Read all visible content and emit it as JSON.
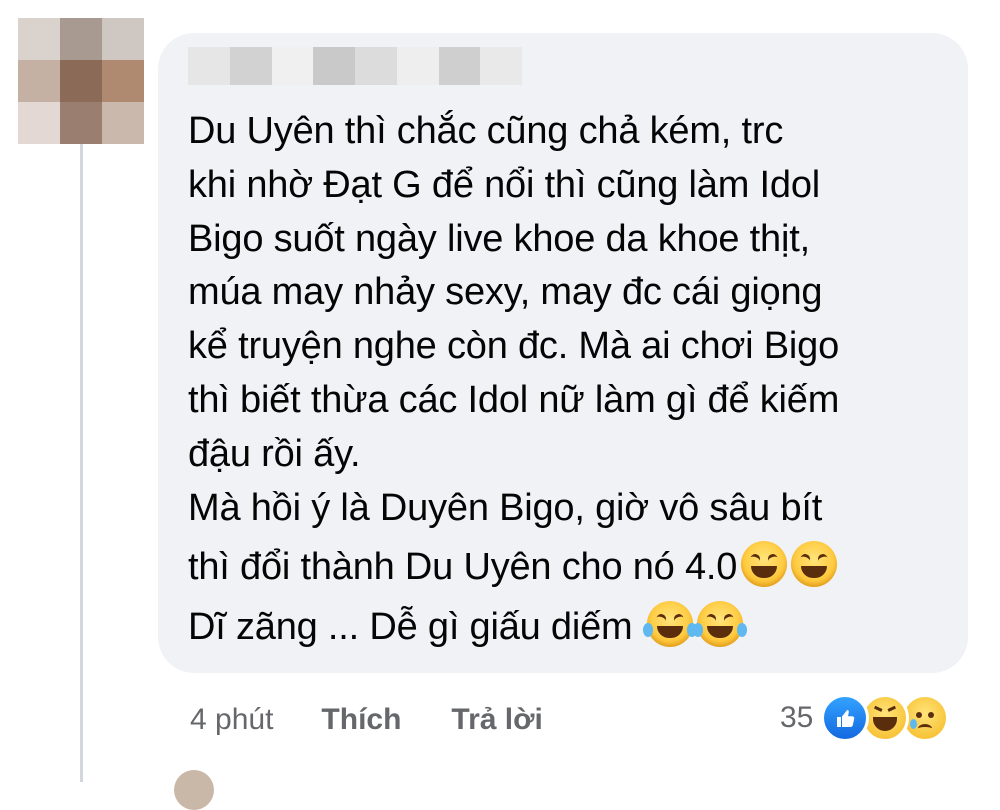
{
  "avatar": {
    "pixels": [
      "#d9d2cd",
      "#a89a90",
      "#cfc7c2",
      "#c4b1a4",
      "#8b6a58",
      "#b08a70",
      "#e3d8d4",
      "#9a7e70",
      "#cbb8ad"
    ]
  },
  "comment": {
    "author_name_blur_colors": [
      "#e6e6e6",
      "#d2d2d2",
      "#f0f0f0",
      "#c9c9c9",
      "#dcdcdc",
      "#eeeeee",
      "#cfcfcf",
      "#e9e9e9"
    ],
    "lines": [
      "Du Uyên thì chắc cũng chả kém, trc",
      "khi nhờ Đạt G để nổi thì cũng làm Idol",
      "Bigo suốt ngày live khoe da khoe thịt,",
      "múa may nhảy sexy, may đc cái giọng",
      "kể truyện nghe còn đc. Mà ai chơi Bigo",
      "thì biết thừa các Idol nữ làm gì để kiếm",
      "đậu rồi ấy.",
      "Mà hồi ý là Duyên Bigo, giờ vô sâu bít"
    ],
    "line_with_emoji_1": "thì đổi thành Du Uyên cho nó 4.0",
    "line_with_emoji_2": "Dĩ zãng ... Dễ gì giấu diếm",
    "emoji_1": "grinning-squinting-face-emoji",
    "emoji_2": "face-with-tears-of-joy-emoji"
  },
  "actions": {
    "time": "4 phút",
    "like_label": "Thích",
    "reply_label": "Trả lời"
  },
  "reactions": {
    "count": "35",
    "icons": [
      "like-reaction-icon",
      "haha-reaction-icon",
      "sad-reaction-icon"
    ]
  },
  "colors": {
    "bubble_bg": "#f0f2f5",
    "secondary_text": "#65676b",
    "like_blue": "#1877f2"
  }
}
